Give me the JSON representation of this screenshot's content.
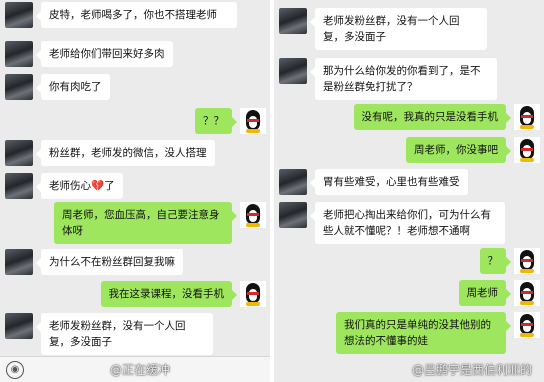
{
  "left_panel": {
    "messages": [
      {
        "dir": "in",
        "text": "皮特，老师喝多了，你也不搭理老师"
      },
      {
        "dir": "in",
        "text": "老师给你们带回来好多肉"
      },
      {
        "dir": "in",
        "text": "你有肉吃了"
      },
      {
        "dir": "out",
        "text": "？？"
      },
      {
        "dir": "in",
        "text": "粉丝群，老师发的微信，没人搭理"
      },
      {
        "dir": "in",
        "text": "老师伤心",
        "suffix": "了",
        "emoji": "💔"
      },
      {
        "dir": "out",
        "text": "周老师，您血压高，自己要注意身体呀"
      },
      {
        "dir": "in",
        "text": "为什么不在粉丝群回复我嘛"
      },
      {
        "dir": "out",
        "text": "我在这录课程，没看手机"
      },
      {
        "dir": "in",
        "text": "老师发粉丝群，没有一个人回复，多没面子"
      }
    ],
    "voice_icon": "voice-icon",
    "watermark": "@正在缓冲"
  },
  "right_panel": {
    "messages": [
      {
        "dir": "in",
        "text": "老师发粉丝群，没有一个人回复，多没面子"
      },
      {
        "dir": "in",
        "text": "那为什么给你发的你看到了，是不是粉丝群免打扰了？"
      },
      {
        "dir": "out",
        "text": "没有呢，我真的只是没看手机"
      },
      {
        "dir": "out",
        "text": "周老师，你没事吧"
      },
      {
        "dir": "in",
        "text": "胃有些难受，心里也有些难受"
      },
      {
        "dir": "in",
        "text": "老师把心掏出来给你们，可为什么有些人就不懂呢？！老师想不通啊"
      },
      {
        "dir": "out",
        "text": "？"
      },
      {
        "dir": "out",
        "text": "周老师"
      },
      {
        "dir": "out",
        "text": "我们真的只是单纯的没其他别的想法的不懂事的娃"
      }
    ],
    "watermark": "@吕鹏宇是西伯利亚的"
  },
  "colors": {
    "outgoing_bubble": "#9ee65e",
    "incoming_bubble": "#ffffff",
    "chat_background": "#ebebeb"
  }
}
